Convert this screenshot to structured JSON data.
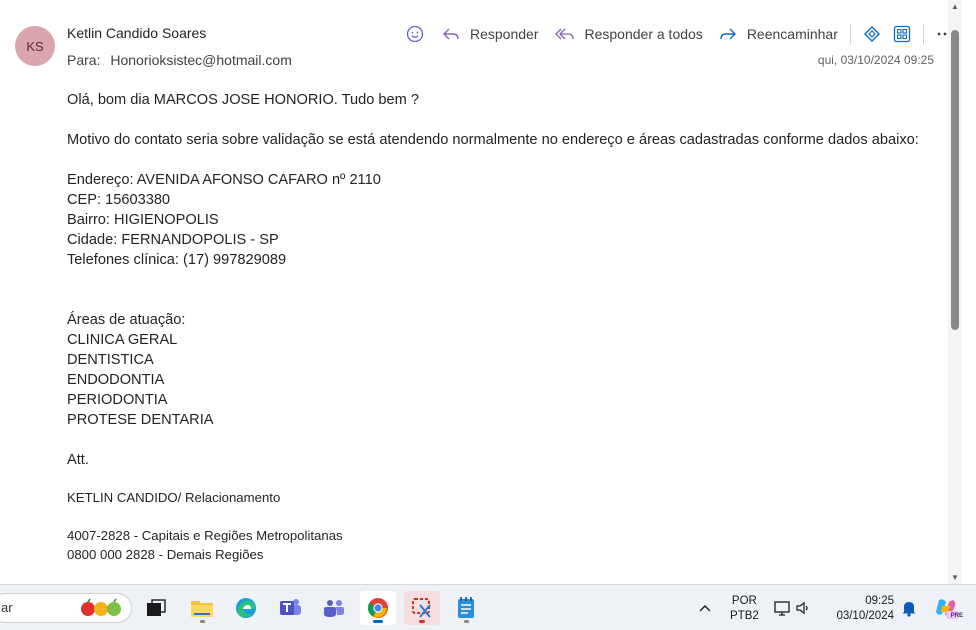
{
  "email": {
    "avatar_initials": "KS",
    "avatar_color": "#dba5ad",
    "sender_name": "Ketlin Candido Soares",
    "to_label": "Para:",
    "to_address": "Honorioksistec@hotmail.com",
    "date": "qui, 03/10/2024 09:25"
  },
  "toolbar": {
    "emoji_icon": "smiley-icon",
    "reply_label": "Responder",
    "reply_all_label": "Responder a todos",
    "forward_label": "Reencaminhar",
    "accent": "#8764b8"
  },
  "body": {
    "greeting": "Olá, bom dia MARCOS JOSE HONORIO. Tudo bem ?",
    "motivo": "Motivo do contato seria sobre validação se está atendendo normalmente no endereço e áreas cadastradas conforme dados abaixo:",
    "address_lines": [
      "Endereço: AVENIDA AFONSO CAFARO nº 2110",
      "CEP: 15603380",
      "Bairro: HIGIENOPOLIS",
      "Cidade: FERNANDOPOLIS - SP",
      "Telefones clínica: (17) 997829089"
    ],
    "areas_title": "Áreas de atuação:",
    "areas": [
      "CLINICA GERAL",
      "DENTISTICA",
      "ENDODONTIA",
      "PERIODONTIA",
      "PROTESE DENTARIA"
    ],
    "att": "Att.",
    "signature": "KETLIN CANDIDO/ Relacionamento",
    "phones": [
      "4007-2828 - Capitais e Regiões Metropolitanas",
      "0800 000 2828 - Demais Regiões"
    ]
  },
  "taskbar": {
    "search_text": "ar",
    "lang_top": "POR",
    "lang_bottom": "PTB2",
    "time": "09:25",
    "date": "03/10/2024",
    "badge": "PRE"
  }
}
